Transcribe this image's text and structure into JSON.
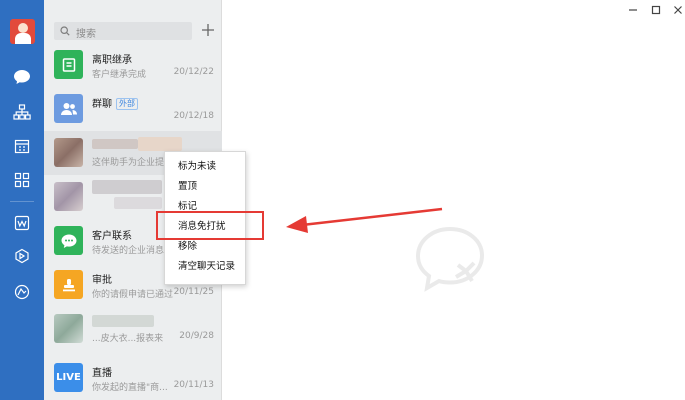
{
  "search": {
    "placeholder": "搜索"
  },
  "chats": [
    {
      "name": "离职继承",
      "preview": "客户继承完成",
      "date": "20/12/22",
      "color": "#2fb35a"
    },
    {
      "name": "群聊",
      "tag": "外部",
      "date": "20/12/18",
      "color": "#5f8fd8"
    },
    {
      "preview": "这伴助手为企业提...",
      "date": ""
    },
    {
      "preview": "",
      "date": ""
    },
    {
      "name": "客户联系",
      "preview": "待发送的企业消息",
      "date": "",
      "color": "#2fb35a"
    },
    {
      "name": "审批",
      "preview": "你的请假申请已通过",
      "date": "20/11/25",
      "color": "#f5a623"
    },
    {
      "preview": "...皮大衣...报表来",
      "date": "20/9/28"
    },
    {
      "name": "直播",
      "preview": "你发起的直播\"商...",
      "date": "20/11/13",
      "color": "#3b8ee9",
      "avatar_text": "LIVE"
    }
  ],
  "context_menu": {
    "items": [
      "标为未读",
      "置顶",
      "标记",
      "消息免打扰",
      "移除",
      "清空聊天记录"
    ],
    "highlighted": "消息免打扰"
  },
  "colors": {
    "rail": "#2f6fc1",
    "annotation": "#e53a34"
  },
  "icons": [
    "chat-icon",
    "org-icon",
    "calendar-icon",
    "apps-icon",
    "doc-icon",
    "drive-icon",
    "cloud-icon",
    "minimize-icon",
    "maximize-icon",
    "close-icon"
  ]
}
